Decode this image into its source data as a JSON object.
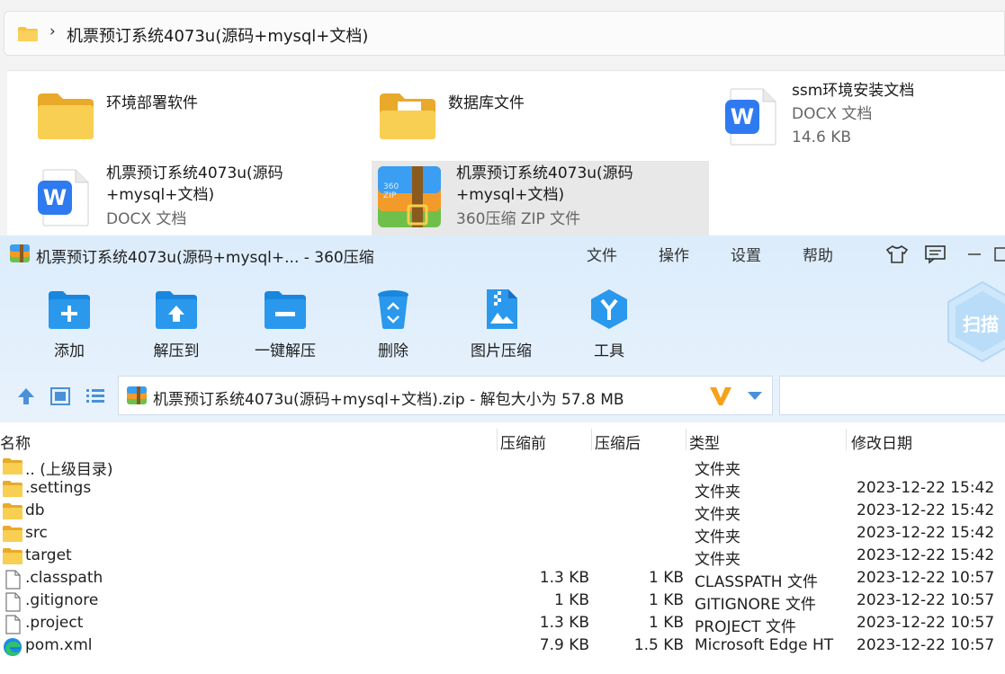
{
  "explorer": {
    "path": "机票预订系统4073u(源码+mysql+文档)",
    "items": [
      {
        "name": "环境部署软件",
        "sub1": "",
        "sub2": "",
        "icon": "folder-icon"
      },
      {
        "name": "数据库文件",
        "sub1": "",
        "sub2": "",
        "icon": "folder-with-document-icon"
      },
      {
        "name": "ssm环境安装文档",
        "sub1": "DOCX 文档",
        "sub2": "14.6 KB",
        "icon": "wps-document-icon"
      },
      {
        "name": "机票预订系统4073u(源码",
        "name2": "+mysql+文档)",
        "sub1": "DOCX 文档",
        "icon": "wps-document-icon"
      },
      {
        "name": "机票预订系统4073u(源码",
        "name2": "+mysql+文档)",
        "sub1": "360压缩 ZIP 文件",
        "icon": "zip-archive-icon",
        "selected": true
      }
    ]
  },
  "zip": {
    "window_title": "机票预订系统4073u(源码+mysql+... - 360压缩",
    "menu": [
      "文件",
      "操作",
      "设置",
      "帮助"
    ],
    "toolbar": [
      "添加",
      "解压到",
      "一键解压",
      "删除",
      "图片压缩",
      "工具"
    ],
    "scan_label": "扫描",
    "path_text": "机票预订系统4073u(源码+mysql+文档).zip - 解包大小为 57.8 MB",
    "columns": [
      "名称",
      "压缩前",
      "压缩后",
      "类型",
      "修改日期"
    ],
    "rows": [
      {
        "name": ".. (上级目录)",
        "before": "",
        "after": "",
        "type": "文件夹",
        "date": "",
        "icon": "folder"
      },
      {
        "name": ".settings",
        "before": "",
        "after": "",
        "type": "文件夹",
        "date": "2023-12-22 15:42",
        "icon": "folder"
      },
      {
        "name": "db",
        "before": "",
        "after": "",
        "type": "文件夹",
        "date": "2023-12-22 15:42",
        "icon": "folder"
      },
      {
        "name": "src",
        "before": "",
        "after": "",
        "type": "文件夹",
        "date": "2023-12-22 15:42",
        "icon": "folder"
      },
      {
        "name": "target",
        "before": "",
        "after": "",
        "type": "文件夹",
        "date": "2023-12-22 15:42",
        "icon": "folder"
      },
      {
        "name": ".classpath",
        "before": "1.3 KB",
        "after": "1 KB",
        "type": "CLASSPATH 文件",
        "date": "2023-12-22 10:57",
        "icon": "file"
      },
      {
        "name": ".gitignore",
        "before": "1 KB",
        "after": "1 KB",
        "type": "GITIGNORE 文件",
        "date": "2023-12-22 10:57",
        "icon": "file"
      },
      {
        "name": ".project",
        "before": "1.3 KB",
        "after": "1 KB",
        "type": "PROJECT 文件",
        "date": "2023-12-22 10:57",
        "icon": "file"
      },
      {
        "name": "pom.xml",
        "before": "7.9 KB",
        "after": "1.5 KB",
        "type": "Microsoft Edge HT",
        "date": "2023-12-22 10:57",
        "icon": "edge"
      }
    ]
  },
  "colors": {
    "folder_yellow": "#f6c340",
    "toolbar_blue": "#1e8ee6",
    "header_bg": "#dcecfb",
    "wps_blue": "#2f7af0"
  }
}
